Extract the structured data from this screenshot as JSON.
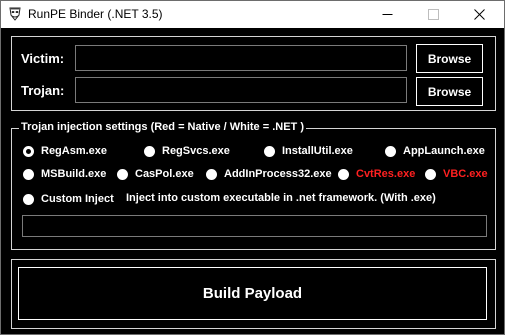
{
  "window": {
    "title": "RunPE Binder (.NET 3.5)"
  },
  "inputs": {
    "victim_label": "Victim:",
    "victim_value": "",
    "trojan_label": "Trojan:",
    "trojan_value": "",
    "browse_label": "Browse"
  },
  "injection": {
    "legend": "Trojan injection settings (Red = Native / White = .NET )",
    "options": [
      {
        "label": "RegAsm.exe",
        "checked": true,
        "native": false
      },
      {
        "label": "RegSvcs.exe",
        "checked": false,
        "native": false
      },
      {
        "label": "InstallUtil.exe",
        "checked": false,
        "native": false
      },
      {
        "label": "AppLaunch.exe",
        "checked": false,
        "native": false
      },
      {
        "label": "MSBuild.exe",
        "checked": false,
        "native": false
      },
      {
        "label": "CasPol.exe",
        "checked": false,
        "native": false
      },
      {
        "label": "AddInProcess32.exe",
        "checked": false,
        "native": false
      },
      {
        "label": "CvtRes.exe",
        "checked": false,
        "native": true
      },
      {
        "label": "VBC.exe",
        "checked": false,
        "native": true
      },
      {
        "label": "Custom Inject",
        "checked": false,
        "native": false
      }
    ],
    "custom_description": "Inject into custom executable in .net framework. (With .exe)",
    "custom_path_value": ""
  },
  "build": {
    "label": "Build Payload"
  },
  "colors": {
    "background": "#000000",
    "text": "#ffffff",
    "native": "#ff2020",
    "border": "#d4d4d4"
  },
  "icons": {
    "app": "masked-figure-icon",
    "minimize": "minimize-icon",
    "maximize": "maximize-icon",
    "close": "close-icon"
  }
}
